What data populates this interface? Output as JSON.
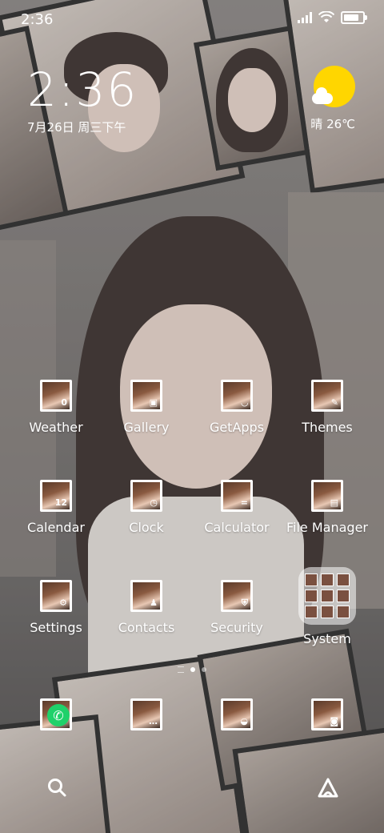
{
  "status_bar": {
    "time": "2:36",
    "icons": [
      "signal-icon",
      "wifi-icon",
      "battery-icon"
    ]
  },
  "clock_widget": {
    "time": "2:36",
    "date": "7月26日 周三下午"
  },
  "weather_widget": {
    "icon": "partly-sunny-icon",
    "text": "晴 26℃",
    "colors": {
      "sun": "#ffd600",
      "cloud": "#ffffff"
    }
  },
  "apps": [
    {
      "label": "Weather",
      "glyph": "0"
    },
    {
      "label": "Gallery",
      "glyph": "▣"
    },
    {
      "label": "GetApps",
      "glyph": "◡"
    },
    {
      "label": "Themes",
      "glyph": "✎"
    },
    {
      "label": "Calendar",
      "glyph": "12"
    },
    {
      "label": "Clock",
      "glyph": "◷"
    },
    {
      "label": "Calculator",
      "glyph": "="
    },
    {
      "label": "File Manager",
      "glyph": "▤"
    },
    {
      "label": "Settings",
      "glyph": "⚙"
    },
    {
      "label": "Contacts",
      "glyph": "♟"
    },
    {
      "label": "Security",
      "glyph": "⛨"
    },
    {
      "label": "System",
      "glyph": ""
    }
  ],
  "dock": [
    {
      "name": "phone",
      "icon": "phone-icon"
    },
    {
      "name": "messages",
      "icon": "message-icon"
    },
    {
      "name": "browser",
      "icon": "browser-icon"
    },
    {
      "name": "camera",
      "icon": "camera-icon"
    }
  ],
  "page_indicator": {
    "pages": 2,
    "current": 1
  },
  "bottom_bar": {
    "left": "search-icon",
    "right": "assistant-icon"
  }
}
